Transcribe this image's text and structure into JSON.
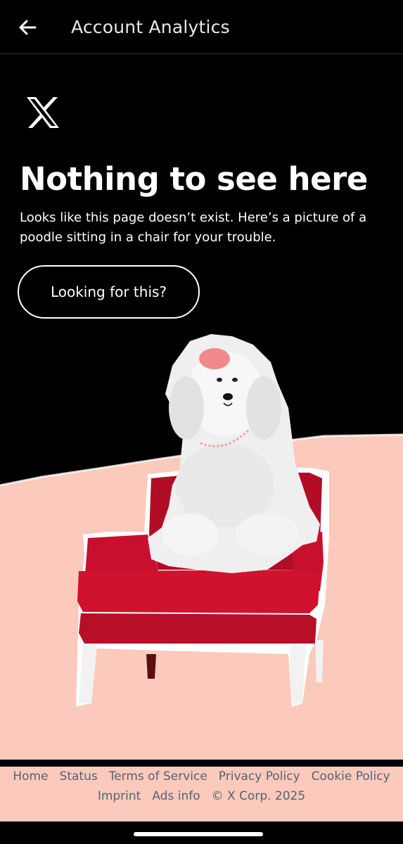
{
  "header": {
    "title": "Account Analytics",
    "back_icon": "arrow-left-icon"
  },
  "brand": {
    "logo_icon": "x-logo-icon"
  },
  "main": {
    "headline": "Nothing to see here",
    "description": "Looks like this page doesn’t exist. Here’s a picture of a poodle sitting in a chair for your trouble.",
    "cta_label": "Looking for this?",
    "illustration": "poodle-in-red-armchair"
  },
  "footer": {
    "links": [
      "Home",
      "Status",
      "Terms of Service",
      "Privacy Policy",
      "Cookie Policy",
      "Imprint",
      "Ads info"
    ],
    "copyright": "© X Corp. 2025"
  },
  "colors": {
    "background": "#000000",
    "accent_pink": "#fcc9bd",
    "chair_red": "#c8102e",
    "footer_text": "#536471"
  }
}
